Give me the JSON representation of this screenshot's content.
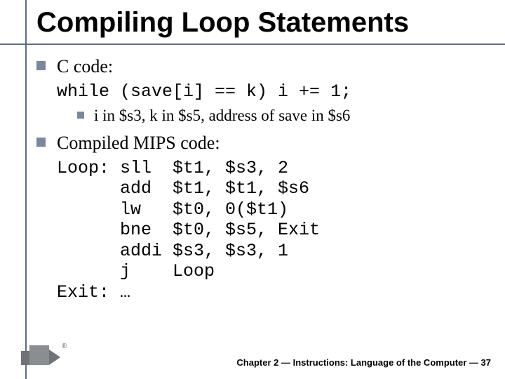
{
  "title": "Compiling Loop Statements",
  "bullets": {
    "b1": {
      "label": "C code:"
    },
    "code1": "while (save[i] == k) i += 1;",
    "b1a": {
      "label": "i in $s3, k in $s5, address of save in $s6"
    },
    "b2": {
      "label": "Compiled MIPS code:"
    },
    "code2": "Loop: sll  $t1, $s3, 2\n      add  $t1, $t1, $s6\n      lw   $t0, 0($t1)\n      bne  $t0, $s5, Exit\n      addi $s3, $s3, 1\n      j    Loop\nExit: …"
  },
  "footer": {
    "chapter": "Chapter 2 — Instructions: Language of the Computer — 37"
  },
  "chart_data": null
}
